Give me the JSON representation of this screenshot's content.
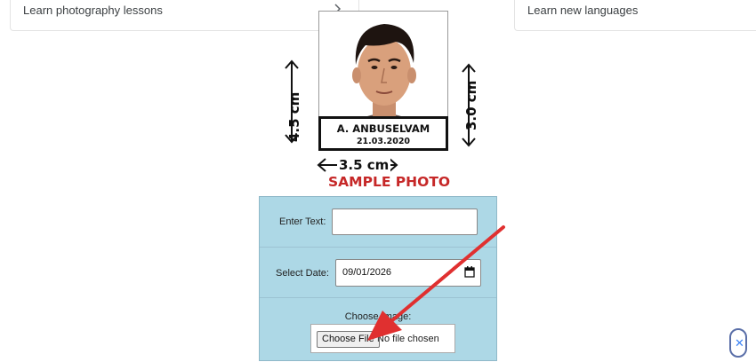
{
  "top_cards": {
    "left_label": "Learn photography lessons",
    "right_label": "Learn new languages",
    "left_icon": "chevron-right-icon"
  },
  "sample_photo": {
    "name": "A. ANBUSELVAM",
    "date": "21.03.2020",
    "height_label": "4.5 cm",
    "right_height_label": "3.0 cm",
    "width_label": "3.5 cm",
    "caption": "SAMPLE PHOTO",
    "caption_color": "#c62828"
  },
  "form": {
    "text_label": "Enter Text:",
    "text_value": "",
    "date_label": "Select Date:",
    "date_value": "09/01/2026",
    "image_label": "Choose Image:",
    "file_button": "Choose File",
    "file_status": "No file chosen",
    "background": "#add8e6"
  },
  "overlay": {
    "close_icon": "close-icon"
  }
}
